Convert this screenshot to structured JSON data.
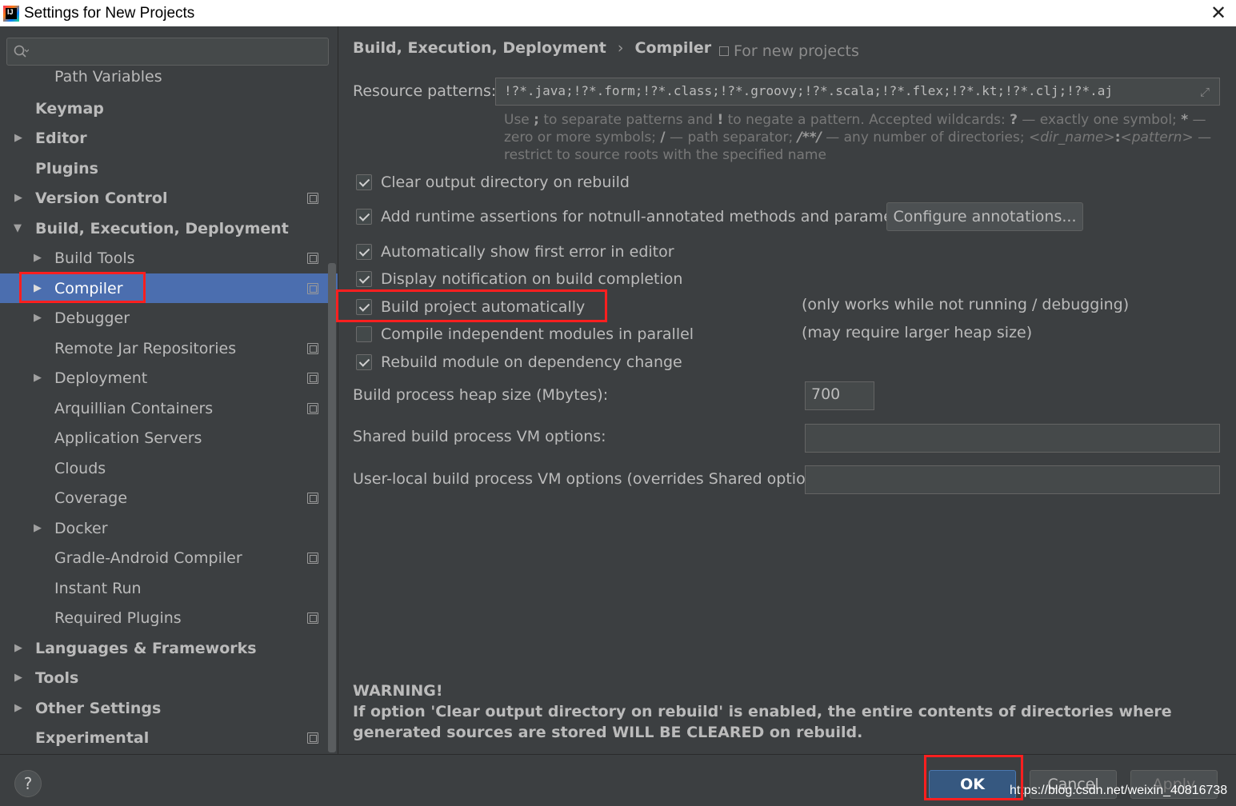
{
  "window": {
    "title": "Settings for New Projects",
    "close_label": "✕"
  },
  "search": {
    "placeholder": ""
  },
  "sidebar": {
    "items": [
      {
        "label": "Path Variables"
      },
      {
        "label": "Keymap"
      },
      {
        "label": "Editor"
      },
      {
        "label": "Plugins"
      },
      {
        "label": "Version Control"
      },
      {
        "label": "Build, Execution, Deployment"
      },
      {
        "label": "Build Tools"
      },
      {
        "label": "Compiler"
      },
      {
        "label": "Debugger"
      },
      {
        "label": "Remote Jar Repositories"
      },
      {
        "label": "Deployment"
      },
      {
        "label": "Arquillian Containers"
      },
      {
        "label": "Application Servers"
      },
      {
        "label": "Clouds"
      },
      {
        "label": "Coverage"
      },
      {
        "label": "Docker"
      },
      {
        "label": "Gradle-Android Compiler"
      },
      {
        "label": "Instant Run"
      },
      {
        "label": "Required Plugins"
      },
      {
        "label": "Languages & Frameworks"
      },
      {
        "label": "Tools"
      },
      {
        "label": "Other Settings"
      },
      {
        "label": "Experimental"
      }
    ]
  },
  "main": {
    "breadcrumb": {
      "parent": "Build, Execution, Deployment",
      "separator": "›",
      "current": "Compiler"
    },
    "scope_label": "For new projects",
    "resource_patterns": {
      "label": "Resource patterns:",
      "value": "!?*.java;!?*.form;!?*.class;!?*.groovy;!?*.scala;!?*.flex;!?*.kt;!?*.clj;!?*.aj"
    },
    "hint": {
      "p1": "Use ",
      "semicolon": ";",
      "p2": " to separate patterns and ",
      "bang": "!",
      "p3": " to negate a pattern. Accepted wildcards: ",
      "q": "?",
      "p4": " — exactly one symbol; ",
      "star": "*",
      "p5": " — zero or more symbols; ",
      "slash": "/",
      "p6": " — path separator; ",
      "dstar": "/**/",
      "p7": " — any number of directories; ",
      "dirname": "<dir_name>",
      "colon": ":",
      "pattern": "<pattern>",
      "p8": " — restrict to source roots with the specified name"
    },
    "checkboxes": {
      "clear_output": "Clear output directory on rebuild",
      "runtime_assertions": "Add runtime assertions for notnull-annotated methods and parameters",
      "show_first_error": "Automatically show first error in editor",
      "notify_completion": "Display notification on build completion",
      "build_automatically": "Build project automatically",
      "parallel": "Compile independent modules in parallel",
      "rebuild_on_change": "Rebuild module on dependency change"
    },
    "configure_annotations_label": "Configure annotations...",
    "notes": {
      "build_auto": "(only works while not running / debugging)",
      "parallel": "(may require larger heap size)"
    },
    "heap": {
      "label": "Build process heap size (Mbytes):",
      "value": "700"
    },
    "shared_vm": {
      "label": "Shared build process VM options:",
      "value": ""
    },
    "local_vm": {
      "label": "User-local build process VM options (overrides Shared options):",
      "value": ""
    },
    "warning": {
      "title": "WARNING!",
      "body": "If option 'Clear output directory on rebuild' is enabled, the entire contents of directories where generated sources are stored WILL BE CLEARED on rebuild."
    }
  },
  "footer": {
    "help": "?",
    "ok": "OK",
    "cancel": "Cancel",
    "apply": "Apply",
    "watermark": "https://blog.csdn.net/weixin_40816738"
  },
  "colors": {
    "selection": "#4b6eaf",
    "highlight": "#ff1f1f",
    "ok_button": "#365880",
    "background": "#3c3f41"
  },
  "icons": {
    "app": "intellij-logo-icon",
    "search": "search-icon",
    "expand": "expand-icon",
    "project_scope": "project-scope-icon"
  }
}
